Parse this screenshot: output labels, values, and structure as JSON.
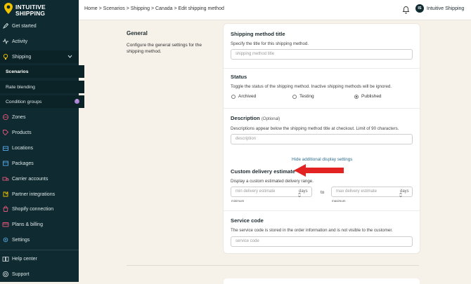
{
  "brand": {
    "line1": "INTUITIVE",
    "line2": "SHIPPING"
  },
  "sidebar": {
    "items": [
      {
        "label": "Get started",
        "icon": "rocket-icon"
      },
      {
        "label": "Activity",
        "icon": "activity-icon"
      },
      {
        "label": "Shipping",
        "icon": "lightbulb-icon"
      },
      {
        "label": "Zones",
        "icon": "globe-icon"
      },
      {
        "label": "Products",
        "icon": "tag-icon"
      },
      {
        "label": "Locations",
        "icon": "building-icon"
      },
      {
        "label": "Packages",
        "icon": "box-icon"
      },
      {
        "label": "Carrier accounts",
        "icon": "truck-icon"
      },
      {
        "label": "Partner integrations",
        "icon": "puzzle-icon"
      },
      {
        "label": "Shopify connection",
        "icon": "shopping-bag-icon"
      },
      {
        "label": "Plans & billing",
        "icon": "credit-card-icon"
      },
      {
        "label": "Settings",
        "icon": "gear-icon"
      },
      {
        "label": "Help center",
        "icon": "book-icon"
      },
      {
        "label": "Support",
        "icon": "help-circle-icon"
      }
    ],
    "subitems": [
      {
        "label": "Scenarios",
        "active": true
      },
      {
        "label": "Rate blending",
        "active": false
      },
      {
        "label": "Condition groups",
        "active": false
      }
    ],
    "condition_badge": "!"
  },
  "header": {
    "breadcrumb": "Home > Scenarios > Shipping > Canada > Edit shipping method",
    "avatar_initials": "IS",
    "account_name": "Intuitive Shipping"
  },
  "general": {
    "title": "General",
    "description": "Configure the general settings for the shipping method."
  },
  "form": {
    "title_section": {
      "heading": "Shipping method title",
      "help": "Specify the title for this shipping method.",
      "placeholder": "shipping method title"
    },
    "status_section": {
      "heading": "Status",
      "help": "Toggle the status of the shipping method. Inactive shipping methods will be ignored.",
      "options": [
        "Archived",
        "Testing",
        "Published"
      ],
      "selected": "Published"
    },
    "description_section": {
      "heading": "Description",
      "optional": "(Optional)",
      "help": "Descriptions appear below the shipping method title at checkout. Limit of 90 characters.",
      "placeholder": "description"
    },
    "toggle_link": "Hide additional display settings",
    "delivery_section": {
      "heading": "Custom delivery estimate",
      "help": "Display a custom estimated delivery range.",
      "min_placeholder": "min delivery estimate",
      "max_placeholder": "max delivery estimate",
      "unit": "days",
      "separator": "to",
      "min_label": "minimum",
      "max_label": "maximum"
    },
    "service_section": {
      "heading": "Service code",
      "help": "The service code is stored in the order information and is not visible to the customer.",
      "placeholder": "service code"
    }
  },
  "colors": {
    "sidebar": "#0f2a30",
    "background": "#f6f2e9",
    "accent_arrow": "#e32222",
    "link": "#2f6f8f"
  }
}
